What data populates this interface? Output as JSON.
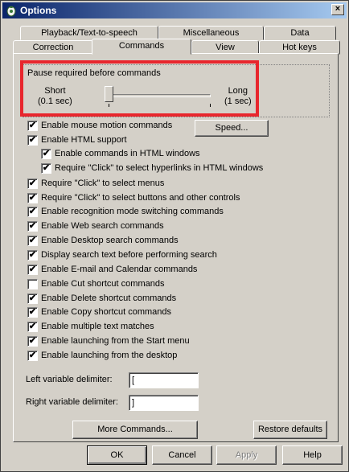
{
  "window": {
    "title": "Options",
    "close_glyph": "×"
  },
  "tabs_row1": [
    "Playback/Text-to-speech",
    "Miscellaneous",
    "Data"
  ],
  "tabs_row2": [
    "Correction",
    "Commands",
    "View",
    "Hot keys"
  ],
  "active_tab": "Commands",
  "pause": {
    "label": "Pause required before commands",
    "short_label": "Short",
    "short_value": "(0.1 sec)",
    "long_label": "Long",
    "long_value": "(1 sec)",
    "slider_level": 0
  },
  "speed_button": "Speed...",
  "checkboxes": [
    {
      "label": "Enable mouse motion commands",
      "checked": true
    },
    {
      "label": "Enable HTML support",
      "checked": true
    },
    {
      "label": "Enable commands in HTML windows",
      "checked": true
    },
    {
      "label": "Require \"Click\" to select hyperlinks in HTML windows",
      "checked": true
    },
    {
      "label": "Require \"Click\" to select menus",
      "checked": true
    },
    {
      "label": "Require \"Click\" to select buttons and other controls",
      "checked": true
    },
    {
      "label": "Enable recognition mode switching commands",
      "checked": true
    },
    {
      "label": "Enable Web search commands",
      "checked": true
    },
    {
      "label": "Enable Desktop search commands",
      "checked": true
    },
    {
      "label": "Display search text before performing search",
      "checked": true
    },
    {
      "label": "Enable E-mail and Calendar commands",
      "checked": true
    },
    {
      "label": "Enable Cut shortcut commands",
      "checked": false
    },
    {
      "label": "Enable Delete shortcut commands",
      "checked": true
    },
    {
      "label": "Enable Copy shortcut commands",
      "checked": true
    },
    {
      "label": "Enable multiple text matches",
      "checked": true
    },
    {
      "label": "Enable launching from the Start menu",
      "checked": true
    },
    {
      "label": "Enable launching from the desktop",
      "checked": true
    }
  ],
  "left_delimiter": {
    "label": "Left variable delimiter:",
    "value": "["
  },
  "right_delimiter": {
    "label": "Right variable delimiter:",
    "value": "]"
  },
  "more_commands_button": "More Commands...",
  "restore_defaults_button": "Restore defaults",
  "footer": {
    "ok": "OK",
    "cancel": "Cancel",
    "apply": "Apply",
    "help": "Help"
  },
  "check_glyph": "✔"
}
